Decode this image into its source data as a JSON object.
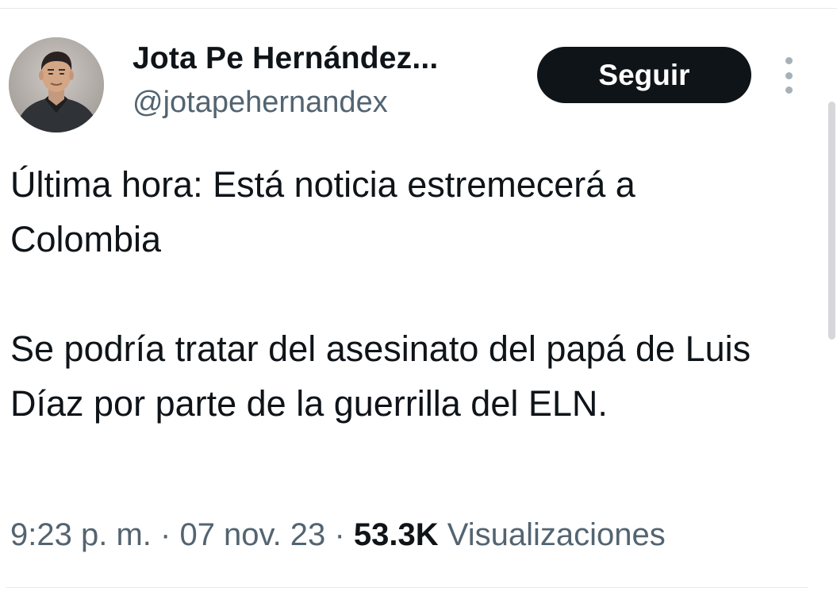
{
  "author": {
    "display_name": "Jota Pe Hernández...",
    "handle": "@jotapehernandex"
  },
  "follow_button_label": "Seguir",
  "more_icon": "more-vertical-icon",
  "tweet": {
    "paragraph_1": "Última hora: Está noticia estremecerá a Colombia",
    "paragraph_2": "Se podría tratar del asesinato del papá de Luis Díaz por parte de la guerrilla del ELN."
  },
  "meta": {
    "time": "9:23 p. m.",
    "separator": "·",
    "date": "07 nov. 23",
    "views_count": "53.3K",
    "views_label": "Visualizaciones"
  },
  "colors": {
    "text_primary": "#0f1419",
    "text_secondary": "#536471",
    "button_bg": "#0f1419",
    "button_text": "#ffffff"
  }
}
